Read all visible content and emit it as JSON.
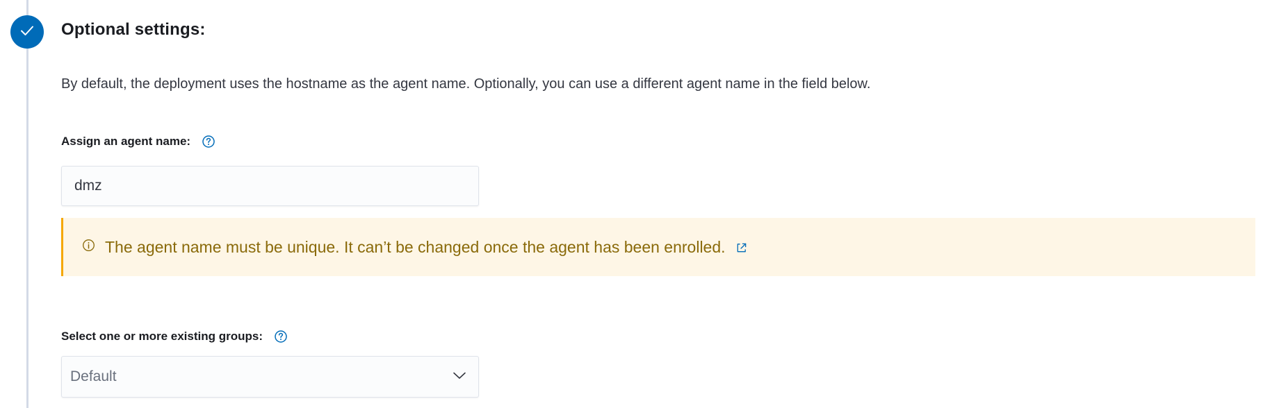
{
  "step": {
    "title": "Optional settings:",
    "description": "By default, the deployment uses the hostname as the agent name. Optionally, you can use a different agent name in the field below."
  },
  "agent_name": {
    "label": "Assign an agent name:",
    "value": "dmz"
  },
  "callout": {
    "text": "The agent name must be unique. It can’t be changed once the agent has been enrolled."
  },
  "groups": {
    "label": "Select one or more existing groups:",
    "selected": "Default"
  },
  "colors": {
    "accent": "#006bb8",
    "warning_border": "#f5a700",
    "warning_bg": "#fef6e6",
    "warning_text": "#8a6a0a"
  }
}
